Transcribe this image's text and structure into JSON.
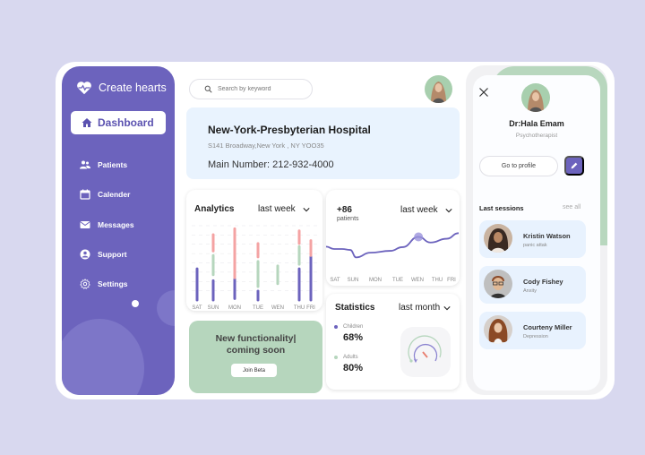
{
  "brand": {
    "name": "Create hearts",
    "icon": "heart-pulse-icon"
  },
  "sidebar": {
    "active": {
      "label": "Dashboard",
      "icon": "home-icon"
    },
    "items": [
      {
        "label": "Patients",
        "icon": "users-icon"
      },
      {
        "label": "Calender",
        "icon": "calendar-icon"
      },
      {
        "label": "Messages",
        "icon": "mail-icon"
      },
      {
        "label": "Support",
        "icon": "user-circle-icon"
      },
      {
        "label": "Settings",
        "icon": "gear-icon"
      }
    ]
  },
  "search": {
    "placeholder": "Search by keyword",
    "value": ""
  },
  "hospital": {
    "name": "New-York-Presbyterian Hospital",
    "address": "S141 Broadway,New York , NY YOO35",
    "phone": "Main Number: 212-932-4000"
  },
  "analytics": {
    "title": "Analytics",
    "period": "last week",
    "days": [
      "SAT",
      "SUN",
      "MON",
      "TUE",
      "WEN",
      "THU",
      "FRI"
    ]
  },
  "patients_card": {
    "value": "+86",
    "label": "patients",
    "period": "last week",
    "days": [
      "SAT",
      "SUN",
      "MON",
      "TUE",
      "WEN",
      "THU",
      "FRI"
    ]
  },
  "statistics": {
    "title": "Statistics",
    "period": "last month",
    "items": [
      {
        "label": "Children",
        "value": "68%",
        "color": "#6c63bd"
      },
      {
        "label": "Adults",
        "value": "80%",
        "color": "#b6d6bd"
      }
    ]
  },
  "promo": {
    "line1": "New functionality|",
    "line2": "coming soon",
    "button": "Join Beta"
  },
  "doctor": {
    "name": "Dr:Hala Emam",
    "role": "Psychotherapist",
    "profile_button": "Go to profile"
  },
  "sessions": {
    "title": "Last sessions",
    "see_all": "see all",
    "items": [
      {
        "name": "Kristin Watson",
        "tag": "panic attak"
      },
      {
        "name": "Cody Fishey",
        "tag": "Anxity"
      },
      {
        "name": "Courteny Miller",
        "tag": "Depression"
      }
    ]
  },
  "colors": {
    "primary": "#6c63bd",
    "green": "#b6d6bd",
    "pink": "#f4a3a3",
    "light_blue": "#e8f2fe",
    "background": "#d8d8ef"
  },
  "chart_data": [
    {
      "type": "bar",
      "title": "Analytics",
      "categories": [
        "SAT",
        "SUN",
        "MON",
        "TUE",
        "WEN",
        "THU",
        "FRI"
      ],
      "ylim": [
        0,
        100
      ],
      "series": [
        {
          "name": "purple",
          "color": "#6c63bd",
          "ranges": [
            [
              0,
              42
            ],
            [
              0,
              26
            ],
            [
              2,
              28
            ],
            [
              0,
              12
            ],
            null,
            [
              0,
              42
            ],
            [
              0,
              58
            ]
          ]
        },
        {
          "name": "green",
          "color": "#b6d6bd",
          "ranges": [
            null,
            [
              34,
              60
            ],
            [
              null
            ],
            [
              18,
              52
            ],
            [
              22,
              46
            ],
            [
              48,
              72
            ],
            null
          ]
        },
        {
          "name": "pink",
          "color": "#f4a3a3",
          "ranges": [
            null,
            [
              66,
              88
            ],
            [
              30,
              96
            ],
            [
              58,
              76
            ],
            null,
            [
              76,
              93
            ],
            [
              60,
              80
            ]
          ]
        }
      ]
    },
    {
      "type": "line",
      "title": "+86 patients",
      "categories": [
        "SAT",
        "SUN",
        "MON",
        "TUE",
        "WEN",
        "THU",
        "FRI"
      ],
      "x": [
        0,
        0.4,
        0.8,
        1.2,
        1.5,
        2.2,
        3.2,
        3.8,
        4.6,
        5.2,
        6.0,
        6.6
      ],
      "y": [
        55,
        50,
        50,
        48,
        32,
        42,
        46,
        54,
        76,
        64,
        72,
        84
      ],
      "ylim": [
        0,
        100
      ],
      "highlight_index": 8
    }
  ]
}
